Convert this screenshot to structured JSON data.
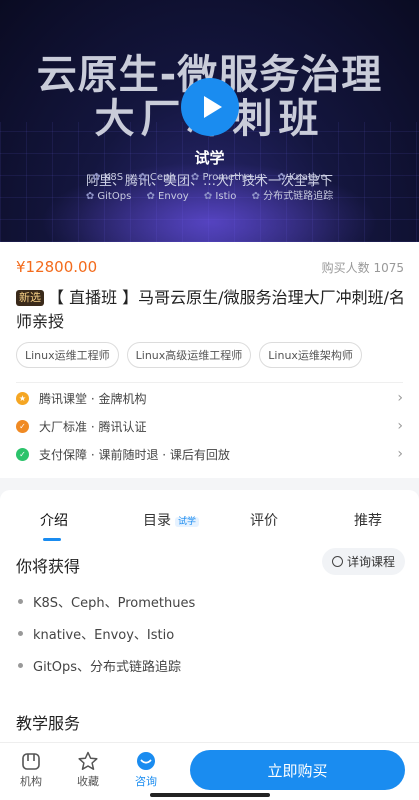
{
  "banner": {
    "title_line1": "云原生-微服务治理",
    "title_line2": "大厂冲刺班",
    "subtitle": "阿里、腾讯、美团、…大厂技术一次全拿下",
    "tags_row1": [
      "K8S",
      "Ceph",
      "Prometheus",
      "Knative"
    ],
    "tags_row2": [
      "GitOps",
      "Envoy",
      "Istio",
      "分布式链路追踪"
    ],
    "trial_label": "试学"
  },
  "course": {
    "price": "¥12800.00",
    "buyers": "购买人数 1075",
    "badge": "新选",
    "title": "【 直播班 】马哥云原生/微服务治理大厂冲刺班/名师亲授",
    "chips": [
      "Linux运维工程师",
      "Linux高级运维工程师",
      "Linux运维架构师"
    ],
    "features": [
      {
        "text": "腾讯课堂 · 金牌机构",
        "color": "#f5a623",
        "icon": "medal-icon"
      },
      {
        "text": "大厂标准 · 腾讯认证",
        "color": "#f08a24",
        "icon": "check-badge-icon"
      },
      {
        "text": "支付保障 · 课前随时退 · 课后有回放",
        "color": "#2cc36b",
        "icon": "shield-check-icon"
      }
    ]
  },
  "tabs": {
    "intro": "介绍",
    "catalog": "目录",
    "catalog_tag": "试学",
    "reviews": "评价",
    "recommend": "推荐"
  },
  "gain": {
    "title": "你将获得",
    "consult": "详询课程",
    "items": [
      "K8S、Ceph、Promethues",
      "knative、Envoy、Istio",
      "GitOps、分布式链路追踪"
    ]
  },
  "service": {
    "title": "教学服务"
  },
  "bottom": {
    "org": "机构",
    "fav": "收藏",
    "consult": "咨询",
    "buy": "立即购买"
  },
  "colors": {
    "accent": "#1a8cf0",
    "price": "#f36b1c"
  }
}
